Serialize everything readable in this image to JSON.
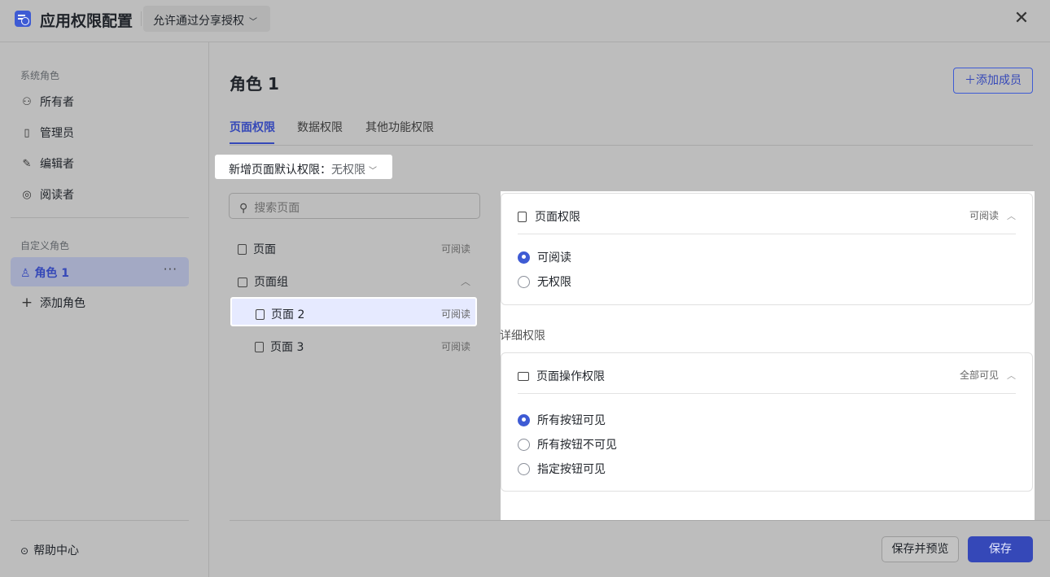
{
  "header": {
    "title": "应用权限配置",
    "share_dropdown": "允许通过分享授权",
    "close": "✕"
  },
  "sidebar": {
    "system_group": "系统角色",
    "system_roles": [
      {
        "label": "所有者",
        "icon": "users-icon"
      },
      {
        "label": "管理员",
        "icon": "building-icon"
      },
      {
        "label": "编辑者",
        "icon": "edit-icon"
      },
      {
        "label": "阅读者",
        "icon": "eye-icon"
      }
    ],
    "custom_group": "自定义角色",
    "active_role": "角色 1",
    "add_role": "添加角色",
    "help": "帮助中心"
  },
  "main": {
    "role_title": "角色 1",
    "add_member": "添加成员",
    "tabs": [
      "页面权限",
      "数据权限",
      "其他功能权限"
    ],
    "active_tab": 0,
    "default_perm_label": "新增页面默认权限：",
    "default_perm_value": "无权限",
    "search_placeholder": "搜索页面",
    "pages": [
      {
        "name": "页面",
        "status": "可阅读"
      },
      {
        "name": "页面组",
        "status": ""
      },
      {
        "name": "页面 2",
        "status": "可阅读"
      },
      {
        "name": "页面 3",
        "status": "可阅读"
      }
    ]
  },
  "panel": {
    "page_perm": {
      "title": "页面权限",
      "summary": "可阅读",
      "options": [
        "可阅读",
        "无权限"
      ],
      "selected": 0
    },
    "detail_label": "详细权限",
    "op_perm": {
      "title": "页面操作权限",
      "summary": "全部可见",
      "options": [
        "所有按钮可见",
        "所有按钮不可见",
        "指定按钮可见"
      ],
      "selected": 0
    }
  },
  "footer": {
    "save_preview": "保存并预览",
    "save": "保存"
  },
  "colors": {
    "accent": "#3548b8",
    "overlay": "#bdbdbd",
    "selected_row": "#e6eaff"
  }
}
